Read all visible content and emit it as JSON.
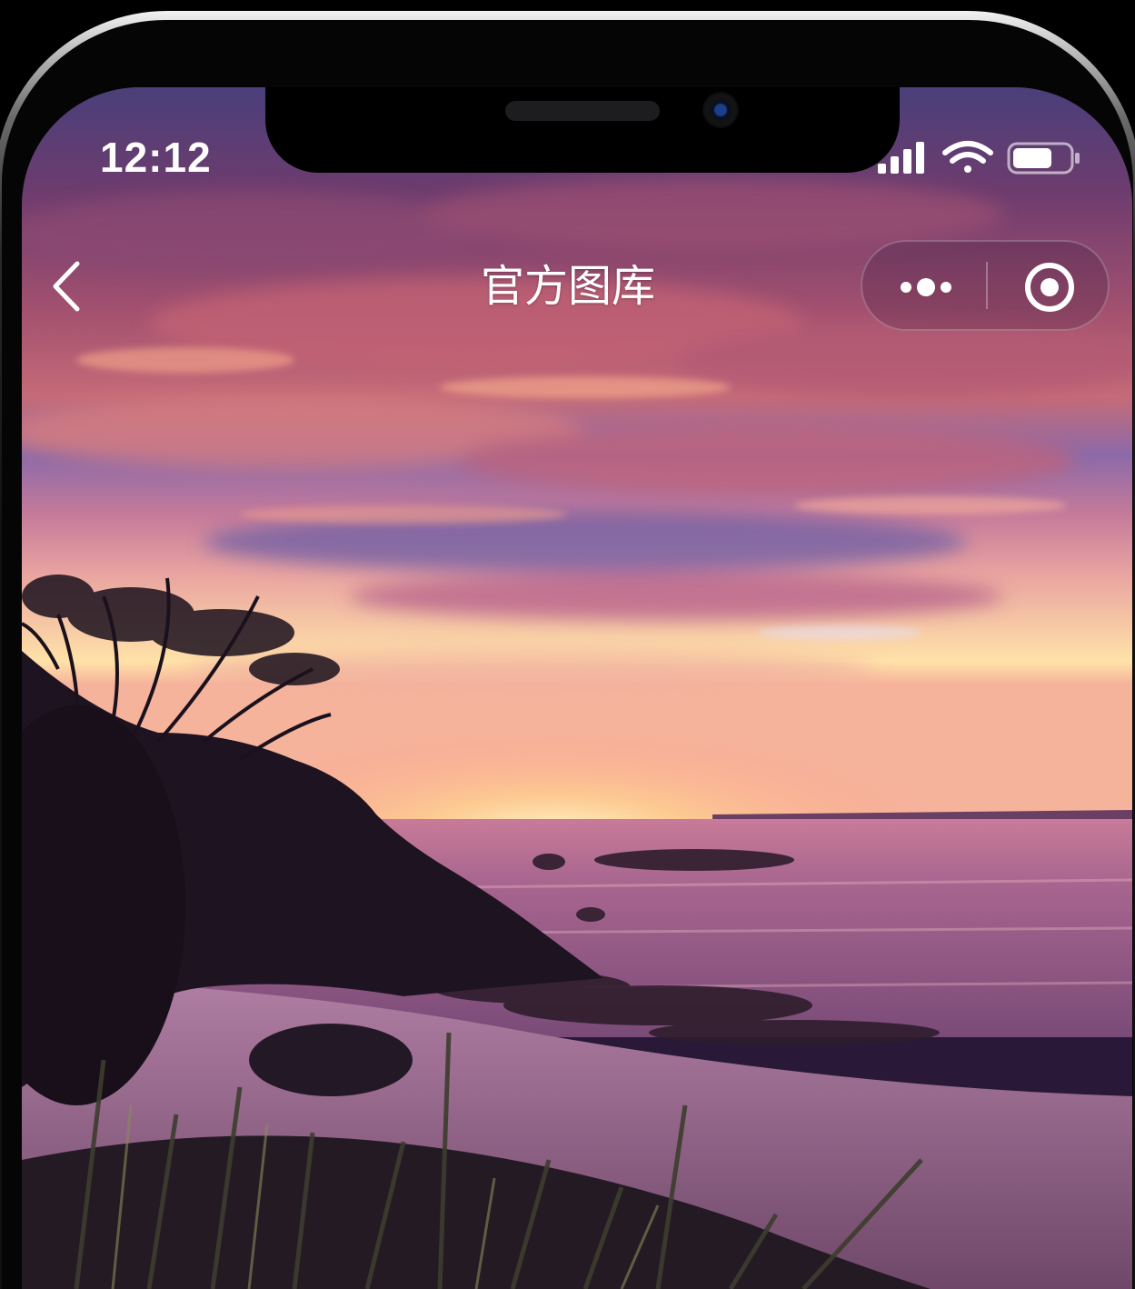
{
  "status_bar": {
    "time": "12:12",
    "icons": [
      "cellular-signal-icon",
      "wifi-icon",
      "battery-icon"
    ]
  },
  "nav_bar": {
    "back_icon": "chevron-left-icon",
    "title": "官方图库",
    "capsule": {
      "more_icon": "more-dots-icon",
      "close_icon": "target-circle-icon"
    }
  },
  "content": {
    "image": "sunset-beach-photo"
  }
}
